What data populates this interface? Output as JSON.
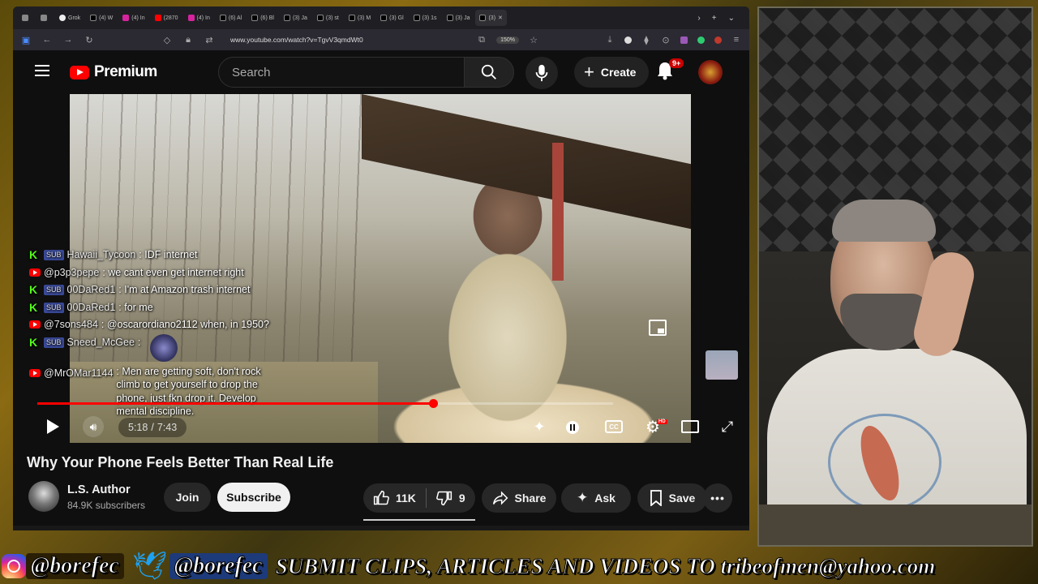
{
  "browser": {
    "tabs": [
      {
        "label": "",
        "favicon": "favicon-icon"
      },
      {
        "label": "",
        "favicon": "tab-icon"
      },
      {
        "label": "Grok",
        "favicon": "grok-icon"
      },
      {
        "label": "(4) W",
        "favicon": "x-icon"
      },
      {
        "label": "(4) In",
        "favicon": "instagram-icon"
      },
      {
        "label": "(2870",
        "favicon": "youtube-icon"
      },
      {
        "label": "(4) In",
        "favicon": "instagram-icon"
      },
      {
        "label": "(6) Al",
        "favicon": "x-icon"
      },
      {
        "label": "(6) Bl",
        "favicon": "x-icon"
      },
      {
        "label": "(3) Ja",
        "favicon": "x-icon"
      },
      {
        "label": "(3) st",
        "favicon": "x-icon"
      },
      {
        "label": "(3) M",
        "favicon": "x-icon"
      },
      {
        "label": "(3) Gl",
        "favicon": "x-icon"
      },
      {
        "label": "(3) 1s",
        "favicon": "x-icon"
      },
      {
        "label": "(3) Ja",
        "favicon": "x-icon"
      },
      {
        "label": "(3)",
        "favicon": "x-icon"
      }
    ],
    "url": "www.youtube.com/watch?v=TgvV3qmdWt0",
    "zoom": "150%"
  },
  "youtube": {
    "logo_text": "Premium",
    "search_placeholder": "Search",
    "create_label": "Create",
    "notification_count": "9+"
  },
  "video": {
    "current_time": "5:18",
    "separator": "/",
    "duration": "7:43",
    "progress_fraction": 0.687,
    "title": "Why Your Phone Feels Better Than Real Life"
  },
  "chat": [
    {
      "platform": "kick",
      "badge": "SUB",
      "user": "Hawaii_Tycoon",
      "msg": ": IDF internet"
    },
    {
      "platform": "youtube",
      "badge": "",
      "user": "@p3p3pepe",
      "msg": ": we cant even get internet right"
    },
    {
      "platform": "kick",
      "badge": "SUB",
      "user": "00DaRed1",
      "msg": ": I'm at Amazon trash internet"
    },
    {
      "platform": "kick",
      "badge": "SUB",
      "user": "00DaRed1",
      "msg": ": for me"
    },
    {
      "platform": "youtube",
      "badge": "",
      "user": "@7sons484",
      "msg": ": @oscarordiano2112 when, in 1950?"
    },
    {
      "platform": "kick",
      "badge": "SUB",
      "user": "Sneed_McGee",
      "msg": ":"
    },
    {
      "platform": "youtube",
      "badge": "",
      "user": "@MrOMar1144",
      "msg": ": Men are getting soft, don't rock climb to get yourself to drop the phone, just fkn drop it. Develop mental discipline."
    }
  ],
  "channel": {
    "name": "L.S. Author",
    "subscribers": "84.9K subscribers",
    "join_label": "Join",
    "subscribe_label": "Subscribe"
  },
  "actions": {
    "likes": "11K",
    "dislikes": "9",
    "share_label": "Share",
    "ask_label": "Ask",
    "save_label": "Save"
  },
  "banner": {
    "instagram_handle": "@borefec",
    "twitter_handle": "@borefec",
    "text": "SUBMIT CLIPS, ARTICLES AND VIDEOS TO tribeofmen@yahoo.com"
  },
  "colors": {
    "youtube_red": "#ff0000",
    "kick_green": "#53fc18",
    "background": "#0f0f0f"
  }
}
